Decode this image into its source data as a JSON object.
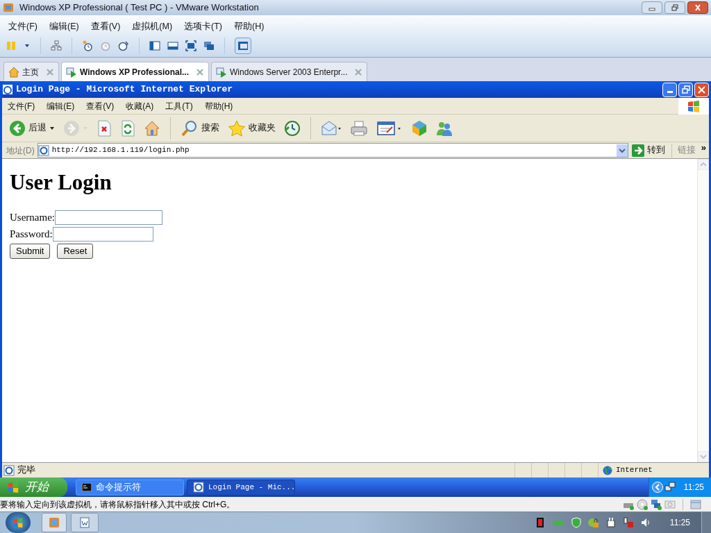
{
  "vmware": {
    "title": "Windows XP Professional ( Test PC ) - VMware Workstation",
    "menu": [
      "文件(F)",
      "编辑(E)",
      "查看(V)",
      "虚拟机(M)",
      "选项卡(T)",
      "帮助(H)"
    ],
    "tabs": [
      {
        "label": "主页",
        "kind": "home",
        "selected": false
      },
      {
        "label": "Windows XP Professional...",
        "kind": "vm",
        "selected": true
      },
      {
        "label": "Windows Server 2003 Enterpr...",
        "kind": "vm",
        "selected": false
      }
    ],
    "status_message": "要将输入定向到该虚拟机，请将鼠标指针移入其中或按 Ctrl+G。"
  },
  "ie": {
    "title": "Login Page - Microsoft Internet Explorer",
    "menu": [
      "文件(F)",
      "编辑(E)",
      "查看(V)",
      "收藏(A)",
      "工具(T)",
      "帮助(H)"
    ],
    "toolbar": [
      {
        "kind": "back",
        "label": "后退",
        "disabled": false
      },
      {
        "kind": "forward",
        "disabled": true
      },
      {
        "kind": "stop",
        "disabled": false
      },
      {
        "kind": "refresh",
        "disabled": false
      },
      {
        "kind": "home",
        "disabled": false
      },
      {
        "kind": "search",
        "label": "搜索",
        "disabled": false
      },
      {
        "kind": "favorites",
        "label": "收藏夹",
        "disabled": false
      },
      {
        "kind": "history",
        "disabled": false
      },
      {
        "kind": "mail",
        "disabled": false
      },
      {
        "kind": "print",
        "disabled": false
      },
      {
        "kind": "edit",
        "disabled": false
      },
      {
        "kind": "cube",
        "disabled": false
      },
      {
        "kind": "messenger",
        "disabled": false
      }
    ],
    "address_label": "地址(D)",
    "url": "http://192.168.1.119/login.php",
    "go": "转到",
    "links": "链接",
    "links_more": "»"
  },
  "page": {
    "heading": "User Login",
    "fields": [
      {
        "label": "Username:"
      },
      {
        "label": "Password:"
      }
    ],
    "buttons": [
      "Submit",
      "Reset"
    ]
  },
  "ie_status": {
    "text": "完毕",
    "zone": "Internet"
  },
  "xp_taskbar": {
    "start": "开始",
    "items": [
      {
        "label": "命令提示符",
        "kind": "console",
        "selected": false
      },
      {
        "label": "Login Page - Mic...",
        "kind": "browser",
        "selected": true
      }
    ],
    "clock": "11:25"
  },
  "win7_taskbar": {
    "clock": "11:25"
  }
}
